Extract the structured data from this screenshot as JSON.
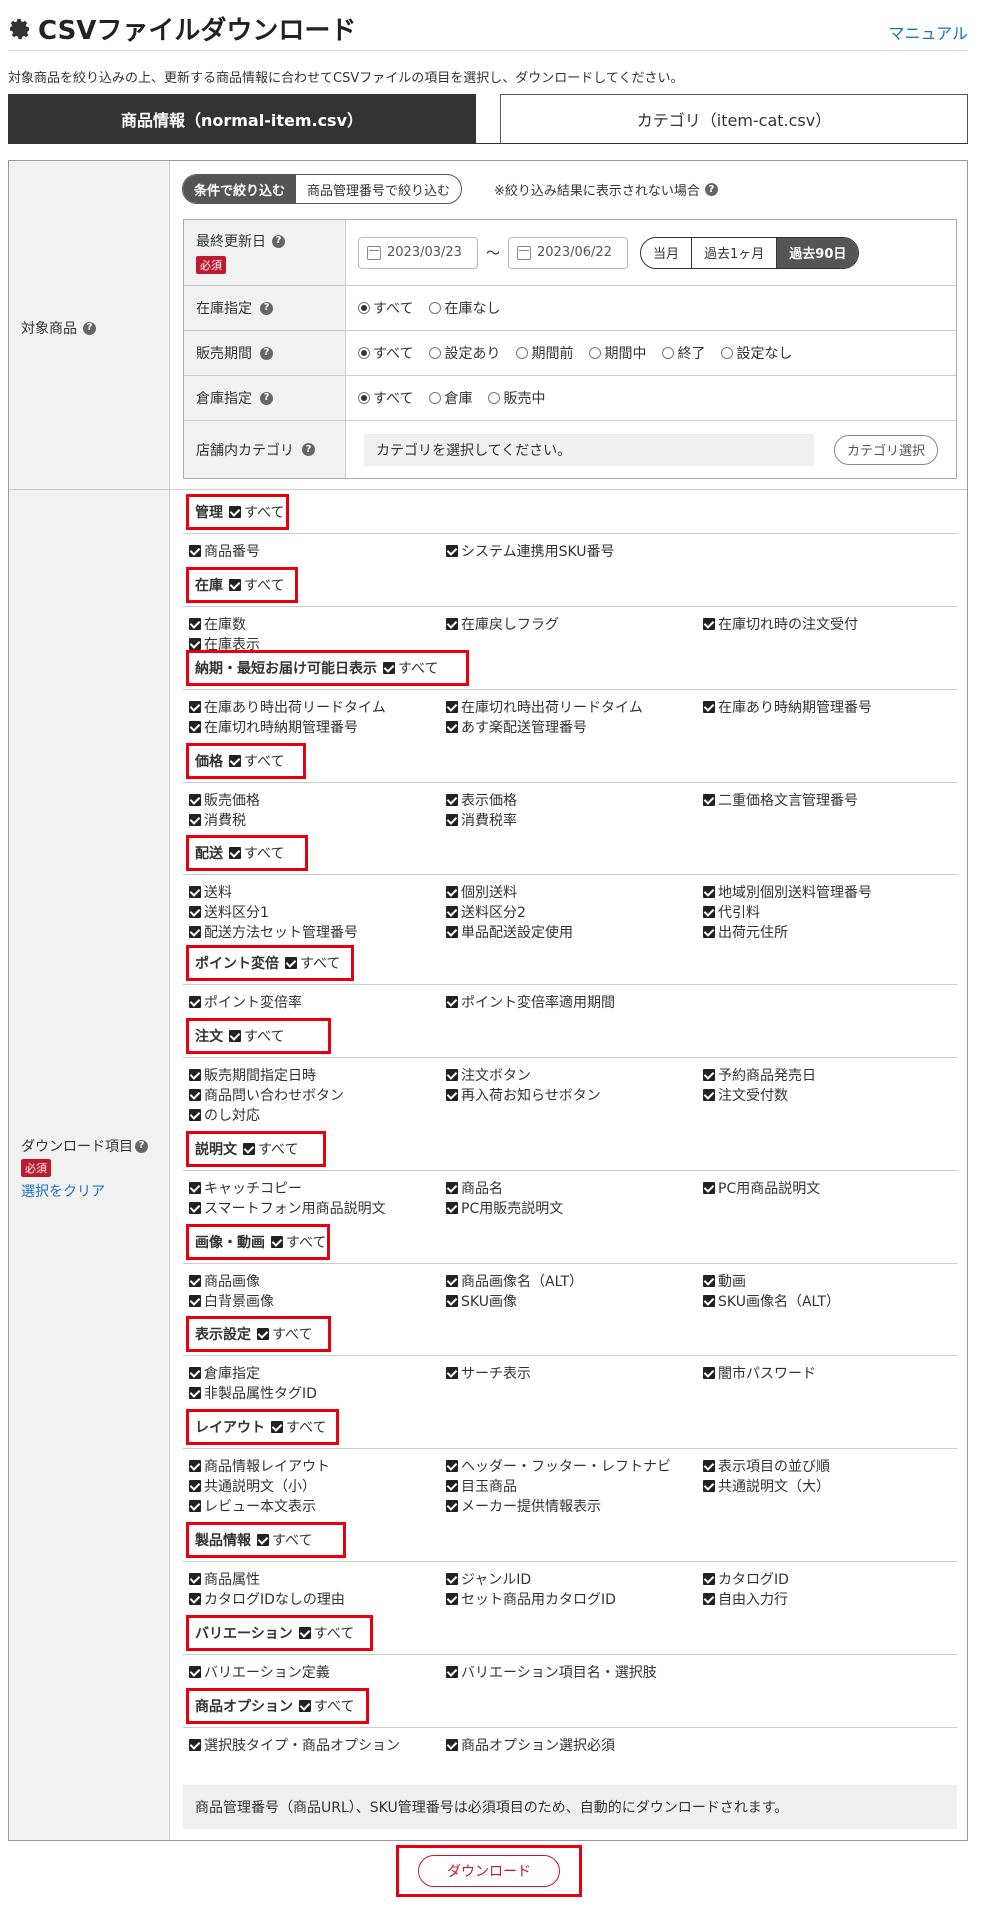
{
  "header": {
    "title": "CSVファイルダウンロード",
    "manual_link": "マニュアル"
  },
  "description": "対象商品を絞り込みの上、更新する商品情報に合わせてCSVファイルの項目を選択し、ダウンロードしてください。",
  "tabs": [
    {
      "label": "商品情報（normal-item.csv）",
      "active": true
    },
    {
      "label": "カテゴリ（item-cat.csv）",
      "active": false
    }
  ],
  "target": {
    "label": "対象商品",
    "filter_tabs": [
      "条件で絞り込む",
      "商品管理番号で絞り込む"
    ],
    "filter_note": "※絞り込み結果に表示されない場合",
    "last_updated": {
      "label": "最終更新日",
      "required": "必須",
      "from": "2023/03/23",
      "sep": "～",
      "to": "2023/06/22",
      "periods": [
        "当月",
        "過去1ヶ月",
        "過去90日"
      ],
      "selected_period": "過去90日"
    },
    "stock": {
      "label": "在庫指定",
      "options": [
        "すべて",
        "在庫なし"
      ],
      "selected": "すべて"
    },
    "sales_period": {
      "label": "販売期間",
      "options": [
        "すべて",
        "設定あり",
        "期間前",
        "期間中",
        "終了",
        "設定なし"
      ],
      "selected": "すべて"
    },
    "warehouse": {
      "label": "倉庫指定",
      "options": [
        "すべて",
        "倉庫",
        "販売中"
      ],
      "selected": "すべて"
    },
    "category": {
      "label": "店舗内カテゴリ",
      "placeholder": "カテゴリを選択してください。",
      "button": "カテゴリ選択"
    }
  },
  "download_items": {
    "label": "ダウンロード項目",
    "required": "必須",
    "clear": "選択をクリア",
    "all_label": "すべて",
    "sections": [
      {
        "name": "管理",
        "items": [
          "商品番号",
          "システム連携用SKU番号"
        ]
      },
      {
        "name": "在庫",
        "items": [
          "在庫数",
          "在庫戻しフラグ",
          "在庫切れ時の注文受付",
          "在庫表示"
        ]
      },
      {
        "name": "納期・最短お届け可能日表示",
        "items": [
          "在庫あり時出荷リードタイム",
          "在庫切れ時出荷リードタイム",
          "在庫あり時納期管理番号",
          "在庫切れ時納期管理番号",
          "あす楽配送管理番号"
        ]
      },
      {
        "name": "価格",
        "items": [
          "販売価格",
          "表示価格",
          "二重価格文言管理番号",
          "消費税",
          "消費税率"
        ]
      },
      {
        "name": "配送",
        "items": [
          "送料",
          "個別送料",
          "地域別個別送料管理番号",
          "送料区分1",
          "送料区分2",
          "代引料",
          "配送方法セット管理番号",
          "単品配送設定使用",
          "出荷元住所"
        ]
      },
      {
        "name": "ポイント変倍",
        "items": [
          "ポイント変倍率",
          "ポイント変倍率適用期間"
        ]
      },
      {
        "name": "注文",
        "items": [
          "販売期間指定日時",
          "注文ボタン",
          "予約商品発売日",
          "商品問い合わせボタン",
          "再入荷お知らせボタン",
          "注文受付数",
          "のし対応"
        ]
      },
      {
        "name": "説明文",
        "items": [
          "キャッチコピー",
          "商品名",
          "PC用商品説明文",
          "スマートフォン用商品説明文",
          "PC用販売説明文"
        ]
      },
      {
        "name": "画像・動画",
        "items": [
          "商品画像",
          "商品画像名（ALT）",
          "動画",
          "白背景画像",
          "SKU画像",
          "SKU画像名（ALT）"
        ]
      },
      {
        "name": "表示設定",
        "items": [
          "倉庫指定",
          "サーチ表示",
          "闇市パスワード",
          "非製品属性タグID"
        ]
      },
      {
        "name": "レイアウト",
        "items": [
          "商品情報レイアウト",
          "ヘッダー・フッター・レフトナビ",
          "表示項目の並び順",
          "共通説明文（小）",
          "目玉商品",
          "共通説明文（大）",
          "レビュー本文表示",
          "メーカー提供情報表示"
        ]
      },
      {
        "name": "製品情報",
        "items": [
          "商品属性",
          "ジャンルID",
          "カタログID",
          "カタログIDなしの理由",
          "セット商品用カタログID",
          "自由入力行"
        ]
      },
      {
        "name": "バリエーション",
        "items": [
          "バリエーション定義",
          "バリエーション項目名・選択肢"
        ]
      },
      {
        "name": "商品オプション",
        "items": [
          "選択肢タイプ・商品オプション",
          "商品オプション選択必須"
        ]
      }
    ],
    "note": "商品管理番号（商品URL）、SKU管理番号は必須項目のため、自動的にダウンロードされます。"
  },
  "download_button": "ダウンロード"
}
